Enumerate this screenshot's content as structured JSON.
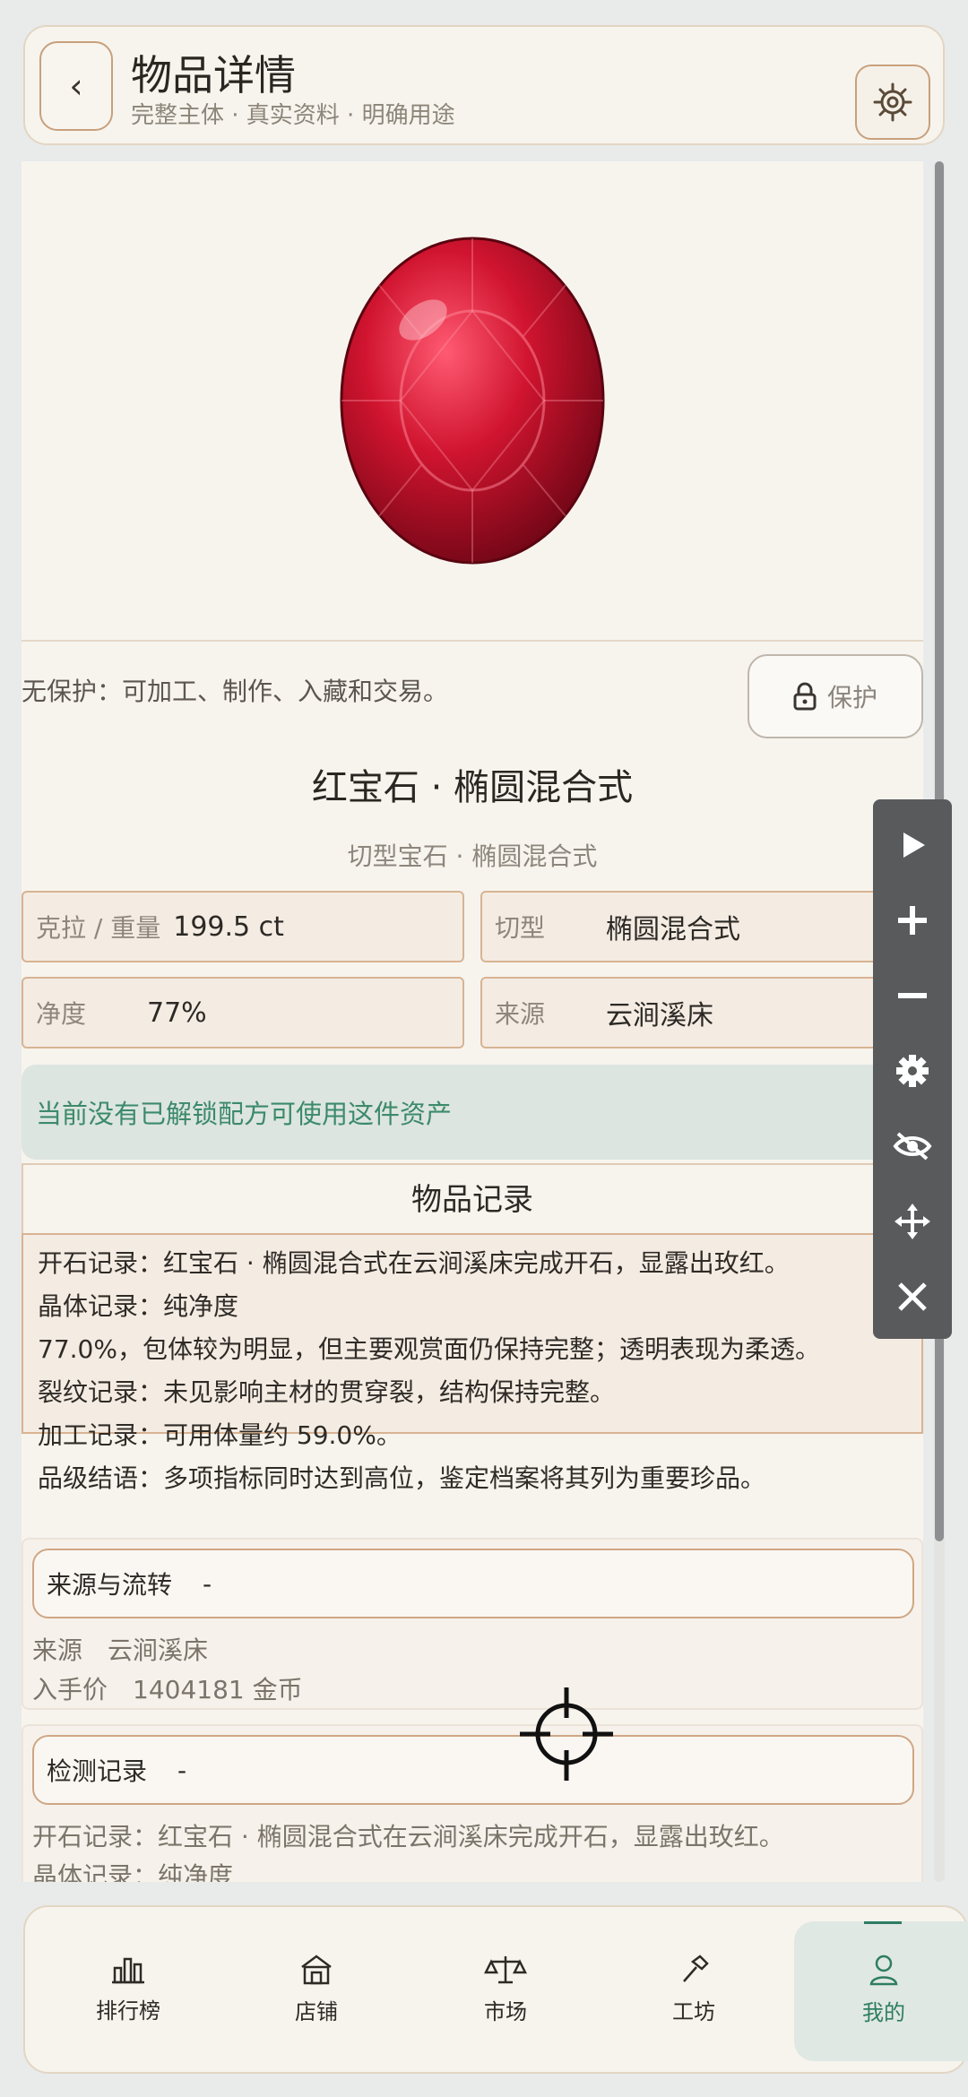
{
  "header": {
    "back_icon": "chevron-left-icon",
    "title": "物品详情",
    "subtitle": "完整主体 · 真实资料 · 明确用途",
    "settings_icon": "ship-wheel-icon"
  },
  "protection": {
    "text": "无保护：可加工、制作、入藏和交易。",
    "button_label": "保护",
    "button_icon": "lock-icon"
  },
  "item": {
    "title": "红宝石 · 椭圆混合式",
    "subtitle": "切型宝石 · 椭圆混合式",
    "stats": {
      "weight_label": "克拉 / 重量",
      "weight_value": "199.5 ct",
      "cut_label": "切型",
      "cut_value": "椭圆混合式",
      "clarity_label": "净度",
      "clarity_value": "77%",
      "source_label": "来源",
      "source_value": "云涧溪床"
    }
  },
  "recipe_notice": "当前没有已解锁配方可使用这件资产",
  "records": {
    "title": "物品记录",
    "lines": [
      "开石记录：红宝石 · 椭圆混合式在云涧溪床完成开石，显露出玫红。",
      "晶体记录：纯净度",
      "77.0%，包体较为明显，但主要观赏面仍保持完整；透明表现为柔透。",
      "裂纹记录：未见影响主材的贯穿裂，结构保持完整。",
      "加工记录：可用体量约 59.0%。",
      "品级结语：多项指标同时达到高位，鉴定档案将其列为重要珍品。"
    ]
  },
  "provenance": {
    "title": "来源与流转",
    "dash": "-",
    "rows": [
      "来源　云涧溪床",
      "入手价　1404181 金币"
    ]
  },
  "inspection": {
    "title": "检测记录",
    "dash": "-",
    "rows": [
      "开石记录：红宝石 · 椭圆混合式在云涧溪床完成开石，显露出玫红。",
      "晶体记录：纯净度"
    ]
  },
  "floating_toolbar": [
    "play-icon",
    "zoom-in-icon",
    "zoom-out-icon",
    "gear-icon",
    "eye-off-icon",
    "move-icon",
    "close-icon"
  ],
  "bottom_nav": [
    {
      "label": "排行榜",
      "icon": "bar-chart-icon"
    },
    {
      "label": "店铺",
      "icon": "shop-icon"
    },
    {
      "label": "市场",
      "icon": "scale-icon"
    },
    {
      "label": "工坊",
      "icon": "hammer-icon"
    },
    {
      "label": "我的",
      "icon": "user-icon"
    }
  ],
  "colors": {
    "accent_green": "#2e7d63",
    "border_tan": "#d8b392",
    "ruby": "#c8102e"
  }
}
